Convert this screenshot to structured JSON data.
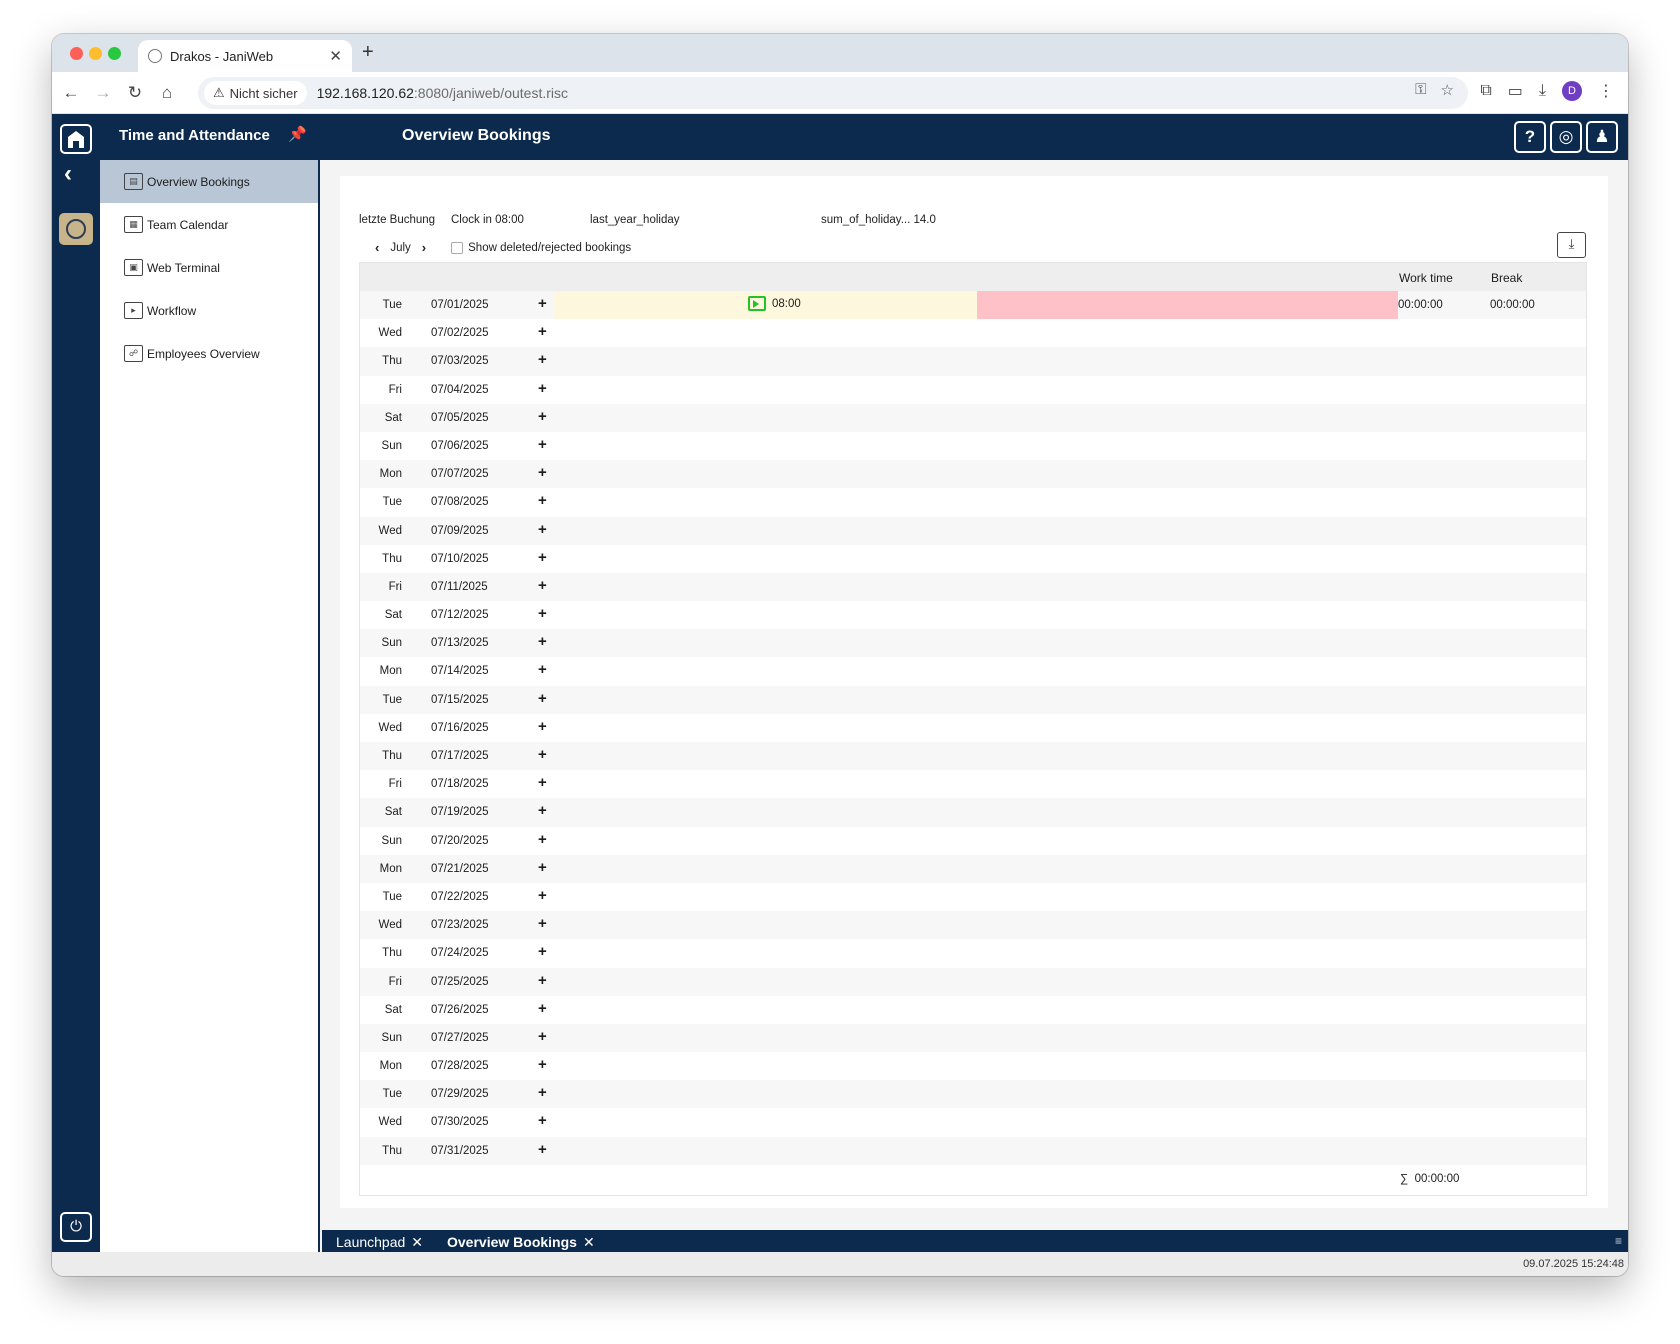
{
  "browser": {
    "tab_title": "Drakos - JaniWeb",
    "security_label": "Nicht sicher",
    "url_host": "192.168.120.62",
    "url_rest": ":8080/janiweb/outest.risc"
  },
  "header": {
    "module_title": "Time and Attendance",
    "page_title": "Overview Bookings"
  },
  "sidebar": {
    "items": [
      {
        "label": "Overview Bookings",
        "active": true
      },
      {
        "label": "Team Calendar"
      },
      {
        "label": "Web Terminal"
      },
      {
        "label": "Workflow"
      },
      {
        "label": "Employees Overview"
      }
    ]
  },
  "info": {
    "last_booking_label": "letzte Buchung",
    "last_booking_value": "Clock in 08:00",
    "holiday_label": "last_year_holiday",
    "sum_holiday": "sum_of_holiday... 14.0"
  },
  "month_nav": {
    "month": "July",
    "show_deleted_label": "Show deleted/rejected bookings"
  },
  "table": {
    "col_work": "Work time",
    "col_break": "Break",
    "first_booking": "08:00",
    "rows": [
      {
        "day": "Tue",
        "date": "07/01/2025",
        "work": "00:00:00",
        "break": "00:00:00"
      },
      {
        "day": "Wed",
        "date": "07/02/2025"
      },
      {
        "day": "Thu",
        "date": "07/03/2025"
      },
      {
        "day": "Fri",
        "date": "07/04/2025"
      },
      {
        "day": "Sat",
        "date": "07/05/2025"
      },
      {
        "day": "Sun",
        "date": "07/06/2025"
      },
      {
        "day": "Mon",
        "date": "07/07/2025"
      },
      {
        "day": "Tue",
        "date": "07/08/2025"
      },
      {
        "day": "Wed",
        "date": "07/09/2025"
      },
      {
        "day": "Thu",
        "date": "07/10/2025"
      },
      {
        "day": "Fri",
        "date": "07/11/2025"
      },
      {
        "day": "Sat",
        "date": "07/12/2025"
      },
      {
        "day": "Sun",
        "date": "07/13/2025"
      },
      {
        "day": "Mon",
        "date": "07/14/2025"
      },
      {
        "day": "Tue",
        "date": "07/15/2025"
      },
      {
        "day": "Wed",
        "date": "07/16/2025"
      },
      {
        "day": "Thu",
        "date": "07/17/2025"
      },
      {
        "day": "Fri",
        "date": "07/18/2025"
      },
      {
        "day": "Sat",
        "date": "07/19/2025"
      },
      {
        "day": "Sun",
        "date": "07/20/2025"
      },
      {
        "day": "Mon",
        "date": "07/21/2025"
      },
      {
        "day": "Tue",
        "date": "07/22/2025"
      },
      {
        "day": "Wed",
        "date": "07/23/2025"
      },
      {
        "day": "Thu",
        "date": "07/24/2025"
      },
      {
        "day": "Fri",
        "date": "07/25/2025"
      },
      {
        "day": "Sat",
        "date": "07/26/2025"
      },
      {
        "day": "Sun",
        "date": "07/27/2025"
      },
      {
        "day": "Mon",
        "date": "07/28/2025"
      },
      {
        "day": "Tue",
        "date": "07/29/2025"
      },
      {
        "day": "Wed",
        "date": "07/30/2025"
      },
      {
        "day": "Thu",
        "date": "07/31/2025"
      }
    ],
    "sum_symbol": "∑",
    "sum_value": "00:00:00"
  },
  "bottom_tabs": [
    {
      "label": "Launchpad"
    },
    {
      "label": "Overview Bookings",
      "active": true
    }
  ],
  "status": {
    "datetime": "09.07.2025 15:24:48"
  }
}
